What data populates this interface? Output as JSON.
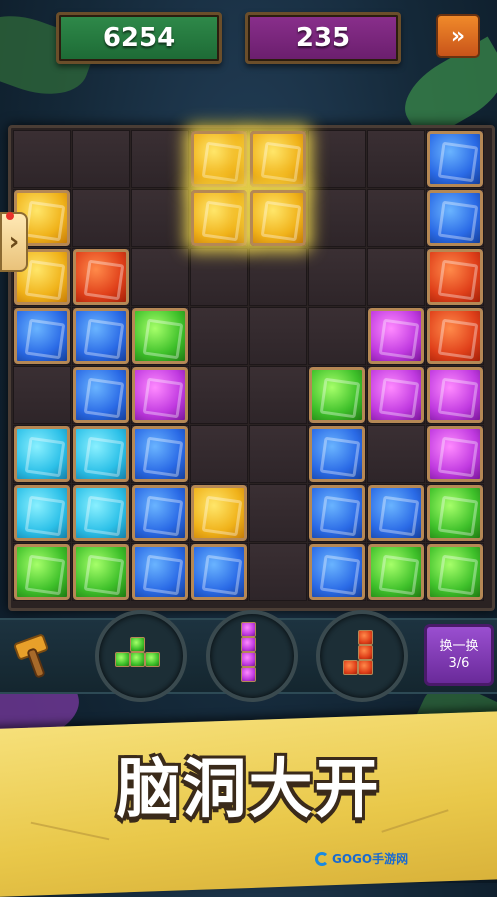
{
  "header": {
    "score": "6254",
    "best_score": "235",
    "fast_forward_icon": "double-chevron-right-icon",
    "fast_forward_label": "»"
  },
  "side_tab": {
    "label": "›"
  },
  "board": {
    "rows": 8,
    "cols": 8,
    "gems": [
      {
        "r": 0,
        "c": 7,
        "color": "blue"
      },
      {
        "r": 1,
        "c": 0,
        "color": "yellow"
      },
      {
        "r": 1,
        "c": 7,
        "color": "blue"
      },
      {
        "r": 2,
        "c": 0,
        "color": "yellow"
      },
      {
        "r": 2,
        "c": 1,
        "color": "red"
      },
      {
        "r": 2,
        "c": 7,
        "color": "red"
      },
      {
        "r": 3,
        "c": 0,
        "color": "blue"
      },
      {
        "r": 3,
        "c": 1,
        "color": "blue"
      },
      {
        "r": 3,
        "c": 2,
        "color": "green"
      },
      {
        "r": 3,
        "c": 6,
        "color": "purple"
      },
      {
        "r": 3,
        "c": 7,
        "color": "red"
      },
      {
        "r": 4,
        "c": 1,
        "color": "blue"
      },
      {
        "r": 4,
        "c": 2,
        "color": "purple"
      },
      {
        "r": 4,
        "c": 5,
        "color": "green"
      },
      {
        "r": 4,
        "c": 6,
        "color": "purple"
      },
      {
        "r": 4,
        "c": 7,
        "color": "purple"
      },
      {
        "r": 5,
        "c": 0,
        "color": "cyan"
      },
      {
        "r": 5,
        "c": 1,
        "color": "cyan"
      },
      {
        "r": 5,
        "c": 2,
        "color": "blue"
      },
      {
        "r": 5,
        "c": 5,
        "color": "blue"
      },
      {
        "r": 5,
        "c": 7,
        "color": "purple"
      },
      {
        "r": 6,
        "c": 0,
        "color": "cyan"
      },
      {
        "r": 6,
        "c": 1,
        "color": "cyan"
      },
      {
        "r": 6,
        "c": 2,
        "color": "blue"
      },
      {
        "r": 6,
        "c": 3,
        "color": "yellow"
      },
      {
        "r": 6,
        "c": 5,
        "color": "blue"
      },
      {
        "r": 6,
        "c": 6,
        "color": "blue"
      },
      {
        "r": 6,
        "c": 7,
        "color": "green"
      },
      {
        "r": 7,
        "c": 0,
        "color": "green"
      },
      {
        "r": 7,
        "c": 1,
        "color": "green"
      },
      {
        "r": 7,
        "c": 2,
        "color": "blue"
      },
      {
        "r": 7,
        "c": 3,
        "color": "blue"
      },
      {
        "r": 7,
        "c": 5,
        "color": "blue"
      },
      {
        "r": 7,
        "c": 6,
        "color": "green"
      },
      {
        "r": 7,
        "c": 7,
        "color": "green"
      }
    ],
    "active_piece": {
      "color": "yellow",
      "cells": [
        [
          0,
          3
        ],
        [
          0,
          4
        ],
        [
          1,
          3
        ],
        [
          1,
          4
        ]
      ]
    }
  },
  "tray": {
    "hammer_icon": "hammer-icon",
    "pieces": [
      {
        "name": "t-piece",
        "color": "green",
        "cells": [
          [
            0,
            1
          ],
          [
            1,
            0
          ],
          [
            1,
            1
          ],
          [
            1,
            2
          ]
        ]
      },
      {
        "name": "i-piece",
        "color": "purple",
        "cells": [
          [
            0,
            0
          ],
          [
            1,
            0
          ],
          [
            2,
            0
          ],
          [
            3,
            0
          ]
        ]
      },
      {
        "name": "j-piece",
        "color": "red",
        "cells": [
          [
            0,
            1
          ],
          [
            1,
            1
          ],
          [
            2,
            0
          ],
          [
            2,
            1
          ]
        ]
      }
    ],
    "swap_label": "换一换",
    "swap_count": "3/6"
  },
  "banner": {
    "title": "脑洞大开"
  },
  "watermark": {
    "text": "GOGO手游网"
  },
  "colors": {
    "yellow": "#f0b21a",
    "red": "#e0401a",
    "blue": "#2a6ae6",
    "cyan": "#2cc0e8",
    "green": "#3ec02a",
    "purple": "#c03ae0",
    "score_panel": "#2f8a4a",
    "best_panel": "#8a2f8c",
    "banner": "#e9c84a"
  }
}
